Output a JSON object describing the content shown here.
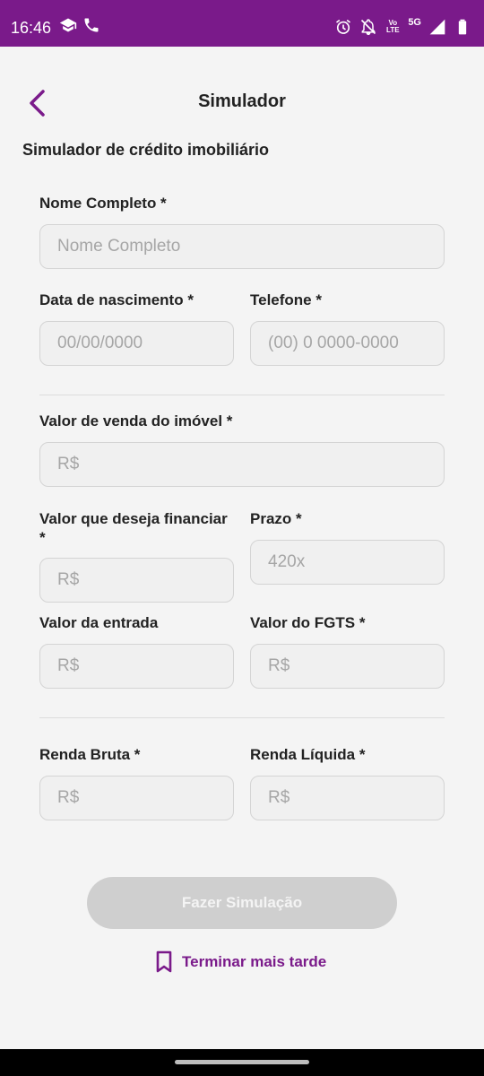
{
  "status_bar": {
    "time": "16:46",
    "volte_label": "Vo LTE",
    "network": "5G",
    "left_icons": [
      "graduation-cap-icon",
      "phone-icon"
    ],
    "right_icons": [
      "alarm-icon",
      "notifications-off-icon",
      "volte-icon",
      "signal-icon",
      "battery-icon"
    ]
  },
  "header": {
    "title": "Simulador",
    "back_icon": "chevron-left-icon"
  },
  "form": {
    "section_title": "Simulador de crédito imobiliário",
    "full_name": {
      "label": "Nome Completo *",
      "placeholder": "Nome Completo"
    },
    "birth_date": {
      "label": "Data de nascimento *",
      "placeholder": "00/00/0000"
    },
    "phone": {
      "label": "Telefone *",
      "placeholder": "(00) 0 0000-0000"
    },
    "property_value": {
      "label": "Valor de venda do imóvel *",
      "placeholder": "R$"
    },
    "financing_value": {
      "label_line1": "Valor que deseja financiar",
      "label_line2": "*",
      "placeholder": "R$"
    },
    "term": {
      "label": "Prazo *",
      "placeholder": "420x"
    },
    "down_payment": {
      "label": "Valor da entrada",
      "placeholder": "R$"
    },
    "fgts_value": {
      "label": "Valor do FGTS *",
      "placeholder": "R$"
    },
    "gross_income": {
      "label": "Renda Bruta *",
      "placeholder": "R$"
    },
    "net_income": {
      "label": "Renda Líquida *",
      "placeholder": "R$"
    }
  },
  "actions": {
    "simulate_label": "Fazer Simulação",
    "finish_later_label": "Terminar mais tarde",
    "finish_later_icon": "bookmark-icon"
  },
  "colors": {
    "accent": "#7a1a8a",
    "disabled_button": "#cfcfcf",
    "background": "#f4f4f4"
  }
}
